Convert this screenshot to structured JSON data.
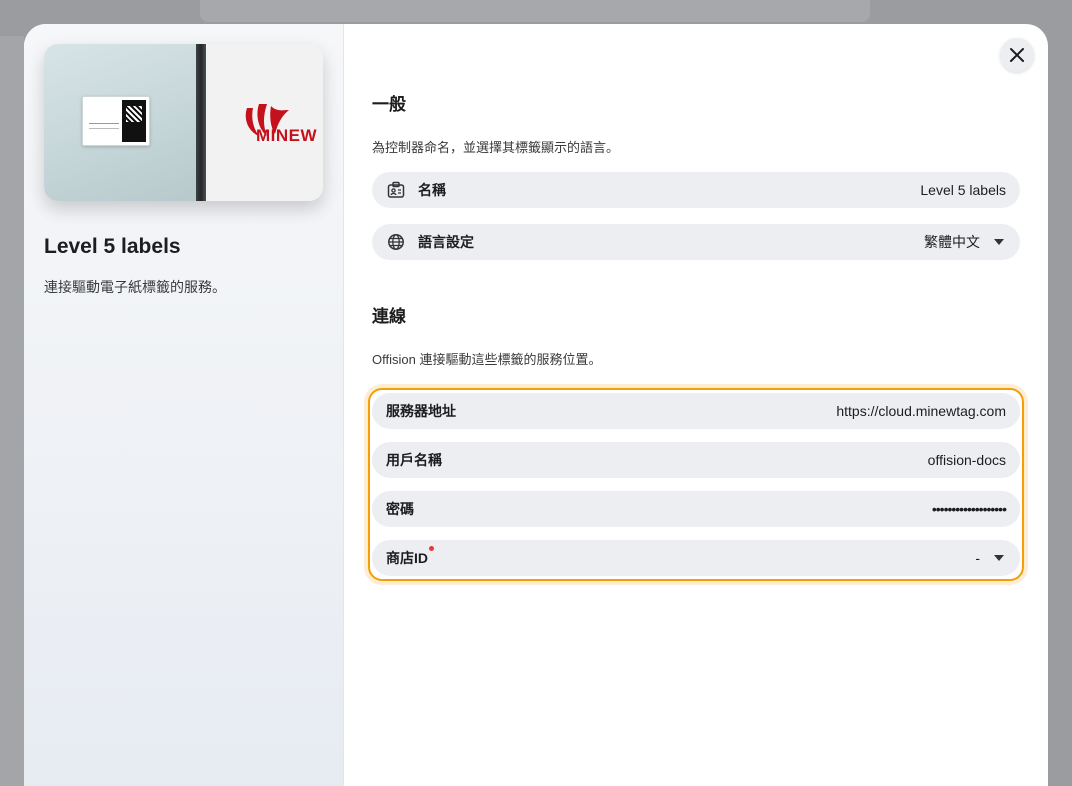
{
  "sidebar": {
    "title": "Level 5 labels",
    "description": "連接驅動電子紙標籤的服務。",
    "logo_text": "MINEW"
  },
  "general": {
    "title": "一般",
    "description": "為控制器命名，並選擇其標籤顯示的語言。",
    "name_label": "名稱",
    "name_value": "Level 5 labels",
    "language_label": "語言設定",
    "language_value": "繁體中文"
  },
  "connection": {
    "title": "連線",
    "description": "Offision 連接驅動這些標籤的服務位置。",
    "server_label": "服務器地址",
    "server_value": "https://cloud.minewtag.com",
    "username_label": "用戶名稱",
    "username_value": "offision-docs",
    "password_label": "密碼",
    "password_value": "•••••••••••••••••••",
    "store_label": "商店ID",
    "store_value": "-"
  },
  "colors": {
    "accent": "#f59e0b",
    "required_dot": "#e53935",
    "brand": "#c3121b"
  },
  "icons": {
    "close": "close-icon",
    "name": "id-card-icon",
    "language": "globe-icon",
    "dropdown": "caret-down-icon"
  }
}
